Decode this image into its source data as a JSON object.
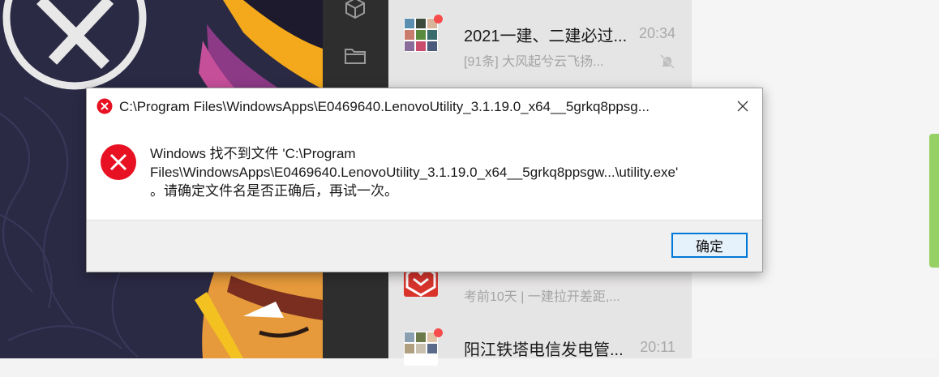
{
  "rail": {
    "icons": [
      "cube-icon",
      "folder-icon"
    ]
  },
  "chats": [
    {
      "title": "2021一建、二建必过...",
      "time": "20:34",
      "preview": "[91条] 大风起兮云飞扬...",
      "unread": true,
      "muted": true
    },
    {
      "title": "",
      "time": "",
      "preview": "考前10天 | 一建拉开差距,...",
      "unread": false,
      "muted": false
    },
    {
      "title": "阳江铁塔电信发电管...",
      "time": "20:11",
      "preview": "",
      "unread": true,
      "muted": false
    }
  ],
  "dialog": {
    "title": "C:\\Program Files\\WindowsApps\\E0469640.LenovoUtility_3.1.19.0_x64__5grkq8ppsg...",
    "message_lines": [
      "Windows 找不到文件 'C:\\Program",
      "Files\\WindowsApps\\E0469640.LenovoUtility_3.1.19.0_x64__5grkq8ppsgw...\\utility.exe'",
      "。请确定文件名是否正确后，再试一次。"
    ],
    "ok_label": "确定"
  },
  "colors": {
    "error_red": "#e81123",
    "button_border": "#0078d7",
    "unread_dot": "#f74c4c",
    "green_bar": "#95d164"
  }
}
